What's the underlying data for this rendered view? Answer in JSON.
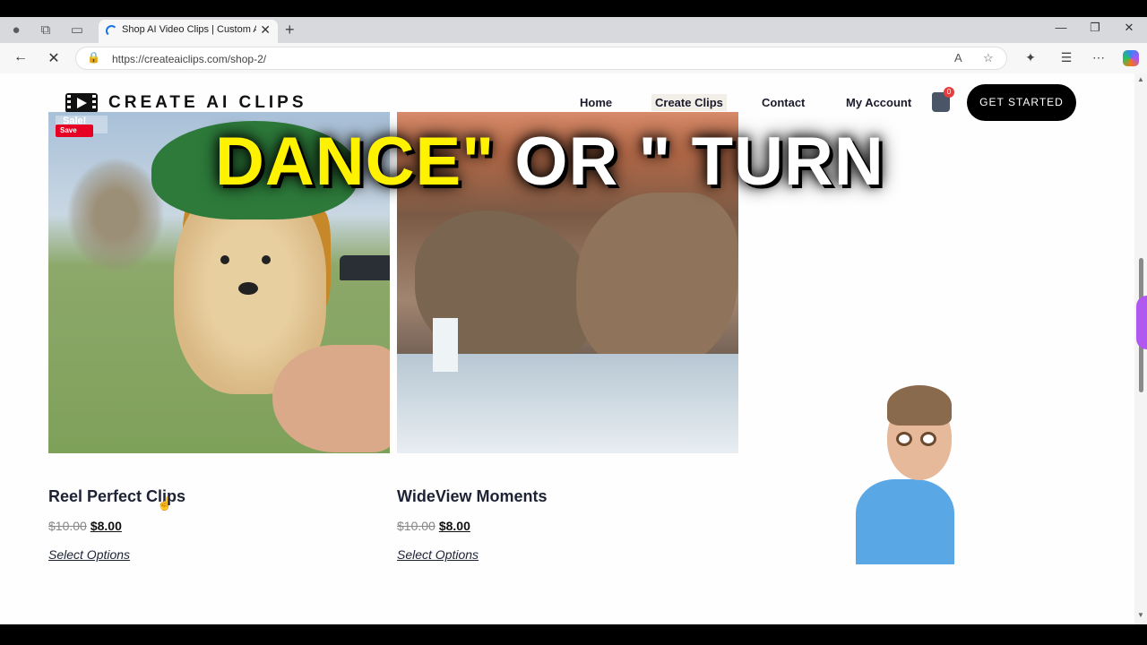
{
  "browser": {
    "tab_title": "Shop AI Video Clips | Custom AI-",
    "url": "https://createaiclips.com/shop-2/",
    "icons": [
      "profile-icon",
      "workspaces-icon",
      "tab-actions-icon",
      "back-icon",
      "stop-icon",
      "lock-icon",
      "read-aloud-icon",
      "favorite-icon",
      "extensions-icon",
      "favorites-icon",
      "more-icon",
      "copilot-icon"
    ]
  },
  "site": {
    "logo_text": "CREATE AI CLIPS",
    "menu": [
      "Home",
      "Create Clips",
      "Contact",
      "My Account"
    ],
    "cart_count": "0",
    "cta": "GET STARTED"
  },
  "overlay": {
    "yellow": "DANCE\"",
    "white": " OR \" TURN"
  },
  "products": [
    {
      "title": "Reel Perfect Clips",
      "old_price": "$10.00",
      "new_price": "$8.00",
      "action": "Select Options",
      "badge": "Sale!",
      "save": "Save"
    },
    {
      "title": "WideView Moments",
      "old_price": "$10.00",
      "new_price": "$8.00",
      "action": "Select Options"
    }
  ]
}
